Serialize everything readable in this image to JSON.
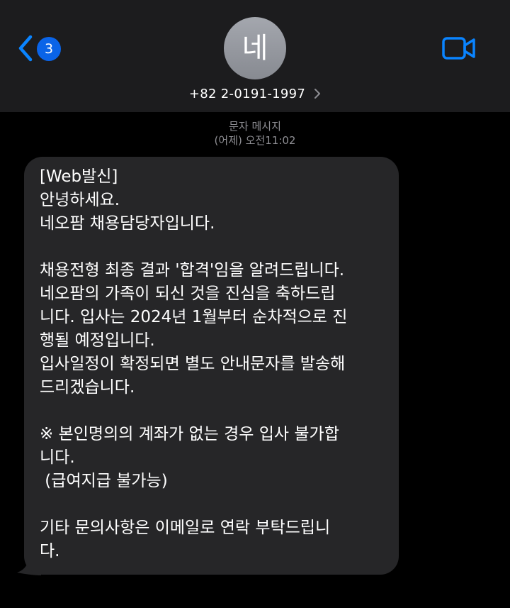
{
  "header": {
    "back_badge_count": "3",
    "avatar_initial": "네",
    "contact_number": "+82 2-0191-1997"
  },
  "meta": {
    "service_label": "문자 메시지",
    "timestamp": "(어제) 오전11:02"
  },
  "message": {
    "lines": [
      "[Web발신]",
      "안녕하세요.",
      "네오팜 채용담당자입니다.",
      "",
      "채용전형 최종 결과 '합격'임을 알려드립니다.",
      "네오팜의 가족이 되신 것을 진심을 축하드립",
      "니다. 입사는 2024년 1월부터 순차적으로 진",
      "행될 예정입니다.",
      "입사일정이 확정되면 별도 안내문자를 발송해",
      "드리겠습니다.",
      "",
      "※ 본인명의의 계좌가 없는 경우 입사 불가합",
      "니다.",
      " (급여지급 불가능)",
      "",
      "기타 문의사항은 이메일로 연락 부탁드립니",
      "다."
    ]
  },
  "colors": {
    "header_bg": "#1c1c1e",
    "accent_blue": "#0a84ff",
    "badge_blue": "#0a64e8",
    "bubble_bg": "#262628",
    "meta_gray": "#8e8e93"
  },
  "icons": {
    "back": "chevron-left-icon",
    "video": "video-camera-icon",
    "contact_more": "chevron-right-icon"
  }
}
